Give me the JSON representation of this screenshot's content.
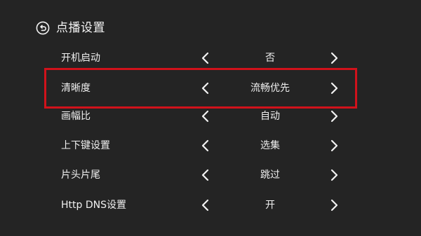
{
  "header": {
    "back_icon": "back-arrow-circle-icon",
    "title": "点播设置"
  },
  "settings": [
    {
      "label": "开机启动",
      "value": "否"
    },
    {
      "label": "清晰度",
      "value": "流畅优先"
    },
    {
      "label": "画幅比",
      "value": "自动"
    },
    {
      "label": "上下键设置",
      "value": "选集"
    },
    {
      "label": "片头片尾",
      "value": "跳过"
    },
    {
      "label": "Http DNS设置",
      "value": "开"
    }
  ],
  "focused_index": 1,
  "colors": {
    "background": "#242424",
    "text": "#f0f0f0",
    "focus_border": "#d0121b"
  }
}
